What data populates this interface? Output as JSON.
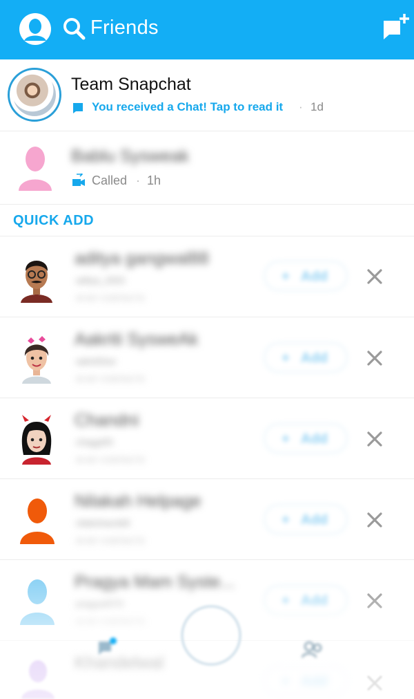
{
  "header": {
    "title": "Friends",
    "accent_color": "#13aef5"
  },
  "team_snapchat": {
    "name": "Team Snapchat",
    "status": "You received a Chat! Tap to read it",
    "separator": "·",
    "time": "1d"
  },
  "recent_call": {
    "name": "Bablu Sysweak",
    "status": "Called",
    "separator": "·",
    "time": "1h"
  },
  "quick_add": {
    "header": "QUICK ADD",
    "add_label": "Add",
    "add_plus": "+",
    "items": [
      {
        "name": "aditya gangwal88",
        "username": "aditya_2003",
        "context": "IN MY CONTACTS"
      },
      {
        "name": "Aakriti SysweAk",
        "username": "aakriti3sw",
        "context": "IN MY CONTACTS"
      },
      {
        "name": "Chandni",
        "username": "chagg4f3",
        "context": "IN MY CONTACTS"
      },
      {
        "name": "Nilakah Helpage",
        "username": "nilakshasnik8",
        "context": "IN MY CONTACTS"
      },
      {
        "name": "Pragya Mam Syste...",
        "username": "pragya4570",
        "context": "IN MY CONTACTS"
      },
      {
        "name": "Khandelwal",
        "username": "",
        "context": ""
      }
    ]
  },
  "colors": {
    "accent": "#13aef5",
    "link": "#16a8ec",
    "muted": "#8a8a8a"
  },
  "icons": {
    "profile": "profile-icon",
    "search": "search-icon",
    "new_chat": "new-chat-icon",
    "chat_bubble": "chat-bubble-icon",
    "video_call": "video-call-icon",
    "dismiss": "close-icon"
  }
}
